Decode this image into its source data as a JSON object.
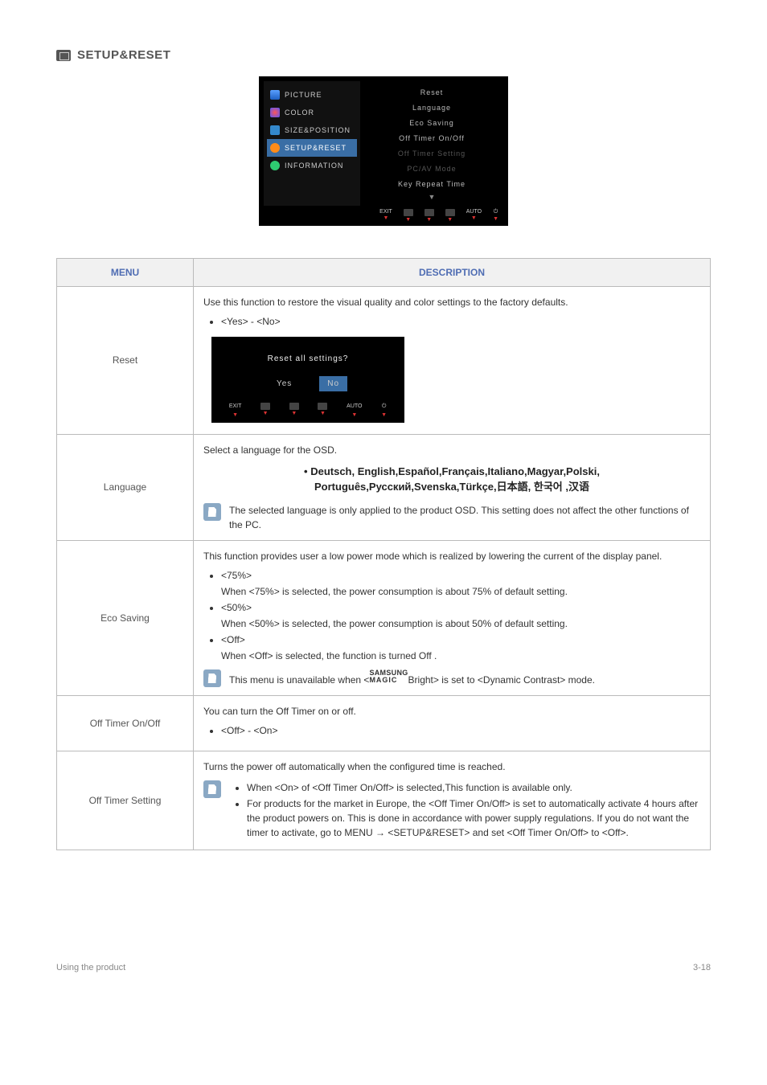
{
  "heading": "SETUP&RESET",
  "osd": {
    "sidebar": [
      {
        "label": "PICTURE"
      },
      {
        "label": "COLOR"
      },
      {
        "label": "SIZE&POSITION"
      },
      {
        "label": "SETUP&RESET"
      },
      {
        "label": "INFORMATION"
      }
    ],
    "options": [
      {
        "label": "Reset",
        "dim": false
      },
      {
        "label": "Language",
        "dim": false
      },
      {
        "label": "Eco Saving",
        "dim": false
      },
      {
        "label": "Off Timer On/Off",
        "dim": false
      },
      {
        "label": "Off Timer Setting",
        "dim": true
      },
      {
        "label": "PC/AV Mode",
        "dim": true
      },
      {
        "label": "Key Repeat Time",
        "dim": false
      }
    ],
    "buttons": {
      "exit": "EXIT",
      "auto": "AUTO"
    }
  },
  "table": {
    "headers": {
      "menu": "MENU",
      "desc": "DESCRIPTION"
    },
    "rows": {
      "reset": {
        "name": "Reset",
        "intro": "Use this function to restore the visual quality and color settings to the factory defaults.",
        "option": "<Yes> - <No>",
        "dialog": {
          "q": "Reset all settings?",
          "yes": "Yes",
          "no": "No",
          "exit": "EXIT",
          "auto": "AUTO"
        }
      },
      "language": {
        "name": "Language",
        "intro": "Select a language for the OSD.",
        "langs_line1": "• Deutsch, English,Español,Français,Italiano,Magyar,Polski,",
        "langs_line2": "Português,Русский,Svenska,Türkçe,日本語, 한국어 ,汉语",
        "note": "The selected language is only applied to the product OSD. This setting does not affect the other functions of the PC."
      },
      "eco": {
        "name": "Eco Saving",
        "intro": "This function provides user a low power mode which is realized by lowering the current of the display panel.",
        "opts": [
          {
            "t": "<75%>",
            "d": "When <75%> is selected, the power consumption is about 75% of default setting."
          },
          {
            "t": "<50%>",
            "d": "When <50%> is selected, the power consumption is about 50% of default setting."
          },
          {
            "t": "<Off>",
            "d": "When <Off> is selected, the function is turned Off ."
          }
        ],
        "note_pre": "This menu is unavailable when <",
        "note_post": "Bright> is set to <Dynamic Contrast> mode.",
        "magic_top": "SAMSUNG",
        "magic_bot": "MAGIC"
      },
      "off_on": {
        "name": "Off Timer On/Off",
        "intro": "You can turn the Off Timer on or off.",
        "option": "<Off> - <On>"
      },
      "off_set": {
        "name": "Off Timer Setting",
        "intro": "Turns the power off automatically when the configured time is reached.",
        "notes": [
          "When <On> of <Off Timer On/Off> is selected,This function is available only.",
          "For products for the market in Europe, the <Off Timer On/Off> is set to automatically activate 4 hours after the product powers on. This is done in accordance with power supply regulations. If you do not want the timer to activate, go to MENU → <SETUP&RESET> and set <Off Timer On/Off> to <Off>."
        ]
      }
    }
  },
  "footer": {
    "left": "Using the product",
    "right": "3-18"
  }
}
